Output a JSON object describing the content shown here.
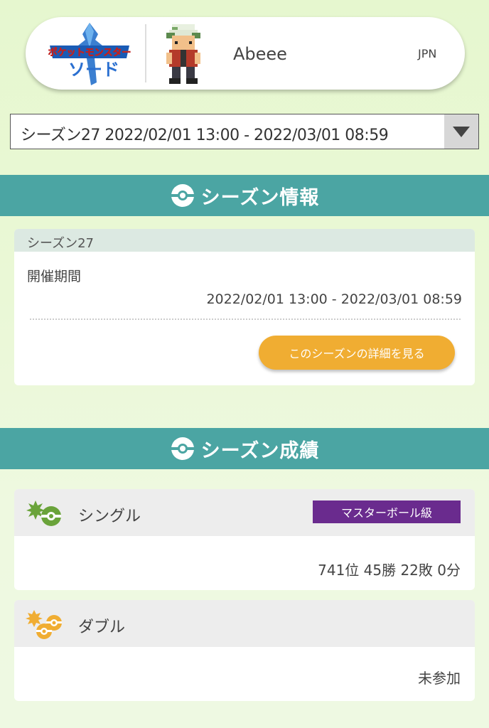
{
  "header": {
    "game_logo_text": "ポケットモンスター ソード",
    "player_name": "Abeee",
    "region": "JPN"
  },
  "season_select": {
    "selected": "シーズン27 2022/02/01 13:00 - 2022/03/01 08:59"
  },
  "season_info": {
    "section_title": "シーズン情報",
    "season_name": "シーズン27",
    "period_label": "開催期間",
    "period_value": "2022/02/01 13:00 - 2022/03/01 08:59",
    "detail_button_label": "このシーズンの詳細を見る"
  },
  "season_results": {
    "section_title": "シーズン成績",
    "single": {
      "title": "シングル",
      "rank_badge": "マスターボール級",
      "record": "741位 45勝 22敗 0分"
    },
    "double": {
      "title": "ダブル",
      "record": "未参加"
    }
  },
  "colors": {
    "section_header": "#4ba5a3",
    "button_orange": "#f0ad32",
    "badge_purple": "#6a2b8e",
    "single_green": "#6aa33a",
    "double_orange": "#f0ad32"
  }
}
